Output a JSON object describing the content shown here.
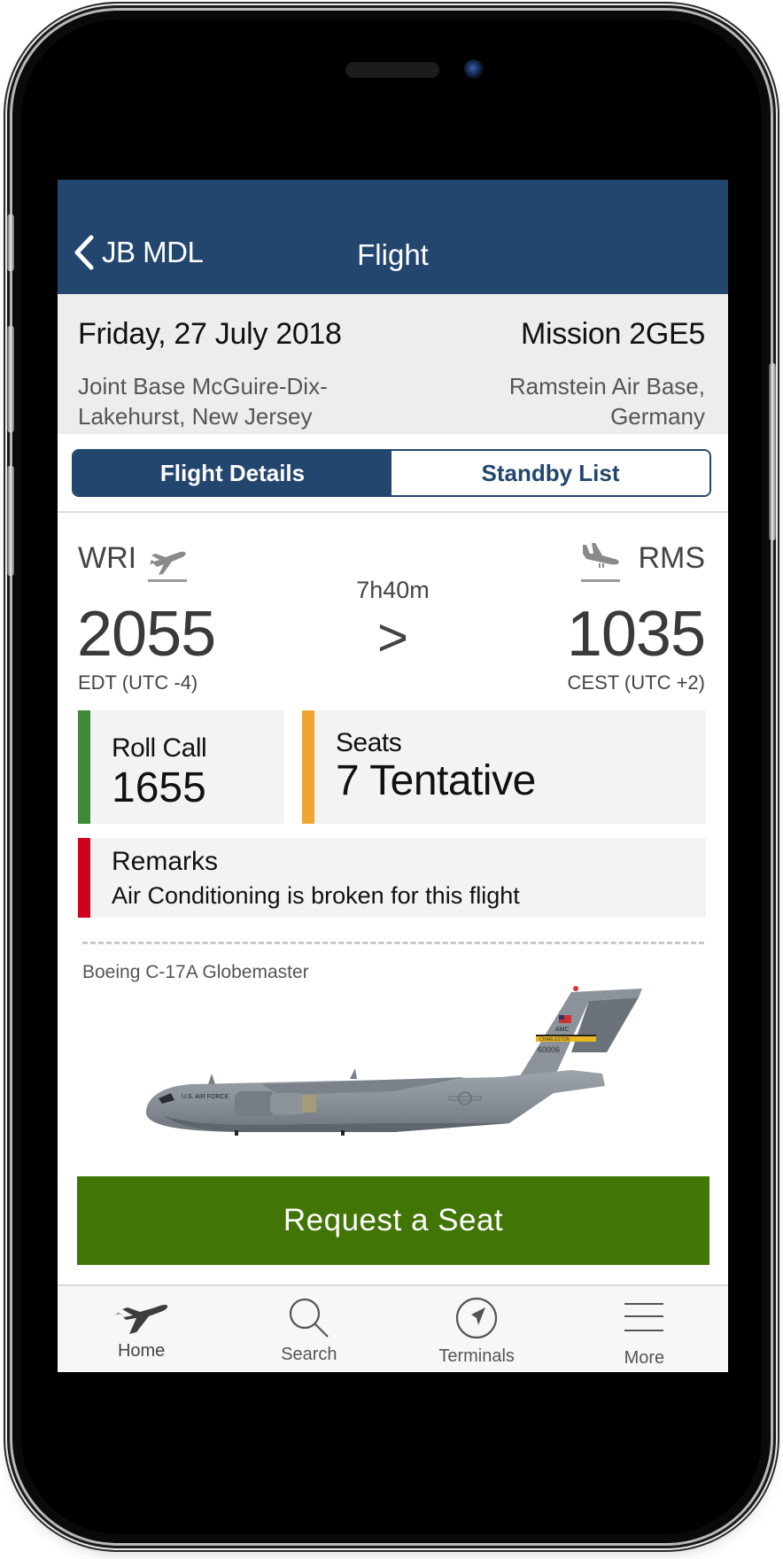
{
  "navbar": {
    "back_label": "JB MDL",
    "title": "Flight",
    "color": "#23466e"
  },
  "flight_header": {
    "date": "Friday, 27 July 2018",
    "mission": "Mission 2GE5",
    "origin": "Joint Base McGuire-Dix-Lakehurst, New Jersey",
    "destination": "Ramstein Air Base, Germany"
  },
  "segment": {
    "tabs": [
      {
        "label": "Flight Details",
        "active": true
      },
      {
        "label": "Standby List",
        "active": false
      }
    ]
  },
  "route": {
    "departure": {
      "code": "WRI",
      "time": "2055",
      "timezone": "EDT (UTC -4)",
      "icon": "takeoff-icon"
    },
    "arrival": {
      "code": "RMS",
      "time": "1035",
      "timezone": "CEST (UTC +2)",
      "icon": "landing-icon"
    },
    "duration": "7h40m",
    "separator": ">"
  },
  "cards": {
    "roll_call": {
      "label": "Roll Call",
      "value": "1655",
      "color": "#3d8b37"
    },
    "seats": {
      "label": "Seats",
      "value": "7 Tentative",
      "color": "#f0a530"
    },
    "remarks": {
      "label": "Remarks",
      "value": "Air Conditioning is broken for this flight",
      "color": "#d0021b"
    }
  },
  "aircraft": {
    "name": "Boeing C-17A Globemaster",
    "markings": {
      "fuselage": "U.S. AIR FORCE",
      "tail_unit": "AMC",
      "tail_band": "CHARLESTON",
      "tail_number": "60006"
    }
  },
  "actions": {
    "request_seat_label": "Request a Seat",
    "color": "#417505"
  },
  "tabbar": {
    "items": [
      {
        "label": "Home",
        "icon": "airplane-icon",
        "active": true
      },
      {
        "label": "Search",
        "icon": "search-icon",
        "active": false
      },
      {
        "label": "Terminals",
        "icon": "compass-icon",
        "active": false
      },
      {
        "label": "More",
        "icon": "menu-icon",
        "active": false
      }
    ]
  }
}
